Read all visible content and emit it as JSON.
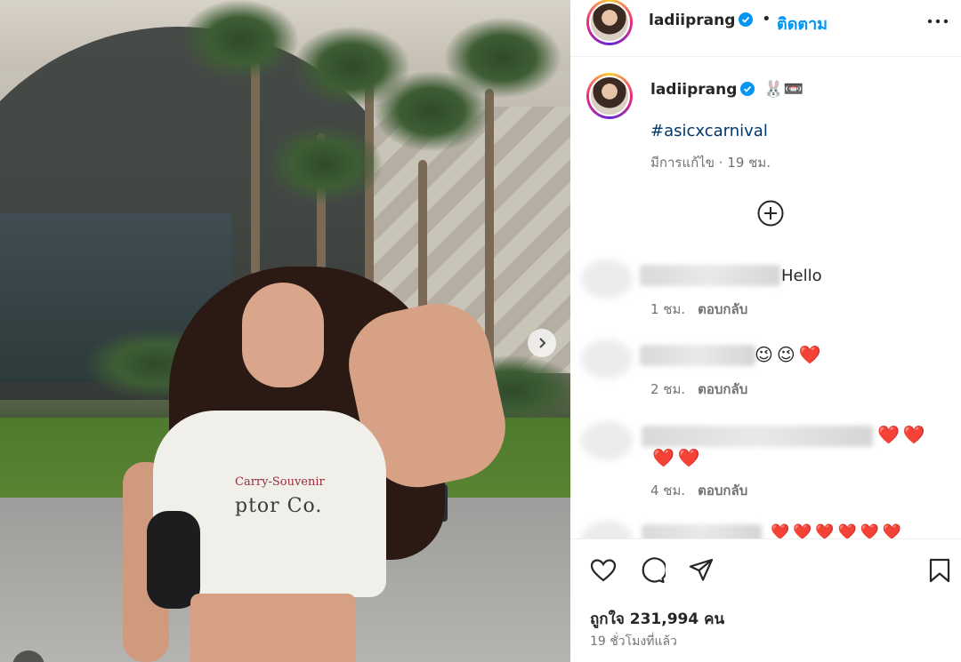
{
  "post": {
    "username": "ladiiprang",
    "follow_label": "ติดตาม",
    "caption_emojis": "🐰📼",
    "hashtag": "#asicxcarnival",
    "edited": "มีการแก้ไข · 19 ชม.",
    "likes": "ถูกใจ 231,994 คน",
    "time_ago": "19 ชั่วโมงที่แล้ว"
  },
  "photo": {
    "shirt_line1": "Carry-Souvenir",
    "shirt_line2": "ptor Co."
  },
  "comments": [
    {
      "text": "Hello",
      "time": "1 ชม.",
      "reply": "ตอบกลับ"
    },
    {
      "text": "😉😉❤️",
      "time": "2 ชม.",
      "reply": "ตอบกลับ"
    },
    {
      "text": "❤️❤️",
      "text2": "❤️❤️",
      "time": "4 ชม.",
      "reply": "ตอบกลับ"
    },
    {
      "text": "❤️❤️❤️❤️❤️❤️"
    }
  ],
  "colors": {
    "follow_blue": "#0095f6",
    "hashtag_blue": "#00376b",
    "verified_blue": "#0095f6"
  },
  "icons": [
    "verified-icon",
    "more-icon",
    "add-circle-icon",
    "like-icon",
    "comment-icon",
    "share-icon",
    "save-icon",
    "next-icon"
  ]
}
